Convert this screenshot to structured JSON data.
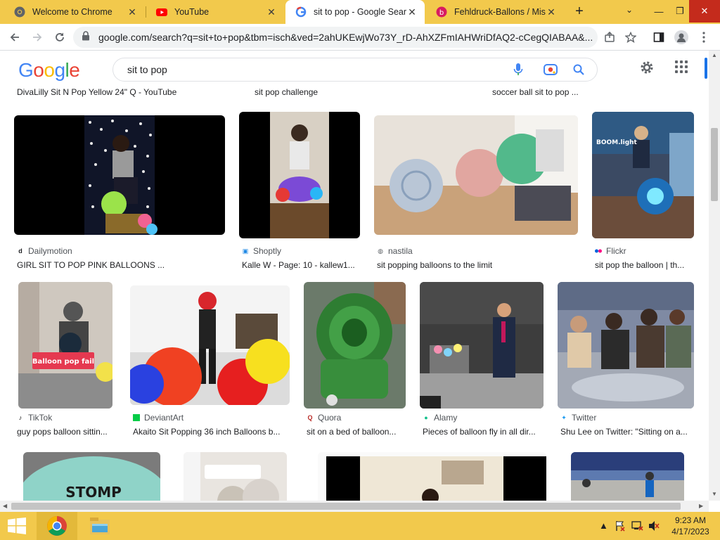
{
  "tabs": [
    {
      "title": "Welcome to Chrome",
      "icon": "chrome-icon"
    },
    {
      "title": "YouTube",
      "icon": "youtube-icon"
    },
    {
      "title": "sit to pop - Google Search",
      "icon": "google-icon"
    },
    {
      "title": "Fehldruck-Ballons / Misprint",
      "icon": "balloon-site-icon"
    }
  ],
  "address": {
    "url": "google.com/search?q=sit+to+pop&tbm=isch&ved=2ahUKEwjWo73Y_rD-AhXZFmIAHWriDfAQ2-cCegQIABAA&..."
  },
  "google": {
    "logo": "Google",
    "query": "sit to pop",
    "brand_colors": [
      "#4285f4",
      "#ea4335",
      "#fbbc05",
      "#4285f4",
      "#34a853",
      "#ea4335"
    ]
  },
  "top_captions": [
    "DivaLilly Sit N Pop Yellow 24\" Q - YouTube",
    "sit pop challenge",
    "soccer ball sit to pop ..."
  ],
  "results": [
    {
      "source": "Dailymotion",
      "caption": "GIRL SIT TO POP PINK BALLOONS ..."
    },
    {
      "source": "Shoptly",
      "caption": "Kalle W - Page: 10 - kallew1..."
    },
    {
      "source": "nastila",
      "caption": "sit popping balloons to the limit"
    },
    {
      "source": "Flickr",
      "caption": "sit pop the balloon | th..."
    },
    {
      "source": "TikTok",
      "caption": "guy pops balloon sittin...",
      "overlay": "Balloon pop fail"
    },
    {
      "source": "DeviantArt",
      "caption": "Akaito Sit Popping 36 inch Balloons b..."
    },
    {
      "source": "Quora",
      "caption": "sit on a bed of balloon..."
    },
    {
      "source": "Alamy",
      "caption": "Pieces of balloon fly in all dir..."
    },
    {
      "source": "Twitter",
      "caption": "Shu Lee on Twitter: \"Sitting on a..."
    }
  ],
  "bottom_row": {
    "stomp_text": "STOMP"
  },
  "taskbar": {
    "time": "9:23 AM",
    "date": "4/17/2023"
  }
}
